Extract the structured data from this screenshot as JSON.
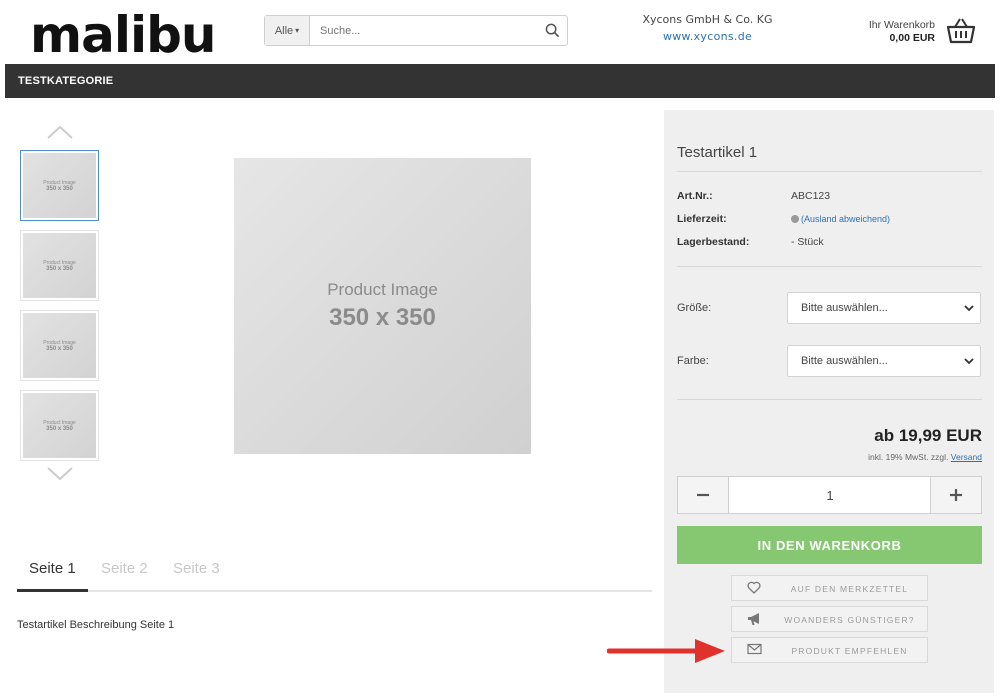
{
  "header": {
    "logo": "malibu",
    "search": {
      "category": "Alle",
      "placeholder": "Suche..."
    },
    "company_name": "Xycons GmbH & Co. KG",
    "company_url": "www.xycons.de",
    "cart_label": "Ihr Warenkorb",
    "cart_amount": "0,00 EUR"
  },
  "nav": {
    "items": [
      "TESTKATEGORIE"
    ]
  },
  "gallery": {
    "thumb_text_line1": "Product Image",
    "thumb_text_line2": "350 x 350",
    "main_text_line1": "Product Image",
    "main_text_line2": "350 x 350"
  },
  "tabs": [
    "Seite 1",
    "Seite 2",
    "Seite 3"
  ],
  "description": "Testartikel Beschreibung Seite 1",
  "product": {
    "title": "Testartikel 1",
    "art_nr_label": "Art.Nr.:",
    "art_nr": "ABC123",
    "delivery_label": "Lieferzeit:",
    "delivery": "(Ausland abweichend)",
    "stock_label": "Lagerbestand:",
    "stock": "- Stück",
    "size_label": "Größe:",
    "size_value": "Bitte auswählen...",
    "color_label": "Farbe:",
    "color_value": "Bitte auswählen...",
    "price": "ab 19,99 EUR",
    "tax_text": "inkl. 19% MwSt. zzgl.",
    "shipping_link": "Versand",
    "quantity": "1",
    "add_to_cart": "IN DEN WARENKORB",
    "wishlist": "AUF DEN MERKZETTEL",
    "cheaper": "WOANDERS GÜNSTIGER?",
    "recommend": "PRODUKT EMPFEHLEN"
  },
  "colors": {
    "nav_bg": "#333333",
    "accent_green": "#86c772",
    "link_blue": "#2a72b5",
    "annotation_red": "#e0322d"
  },
  "icons": [
    "search-icon",
    "basket-icon",
    "chevron-up-icon",
    "chevron-down-icon",
    "heart-icon",
    "megaphone-icon",
    "envelope-icon",
    "red-arrow-icon"
  ]
}
